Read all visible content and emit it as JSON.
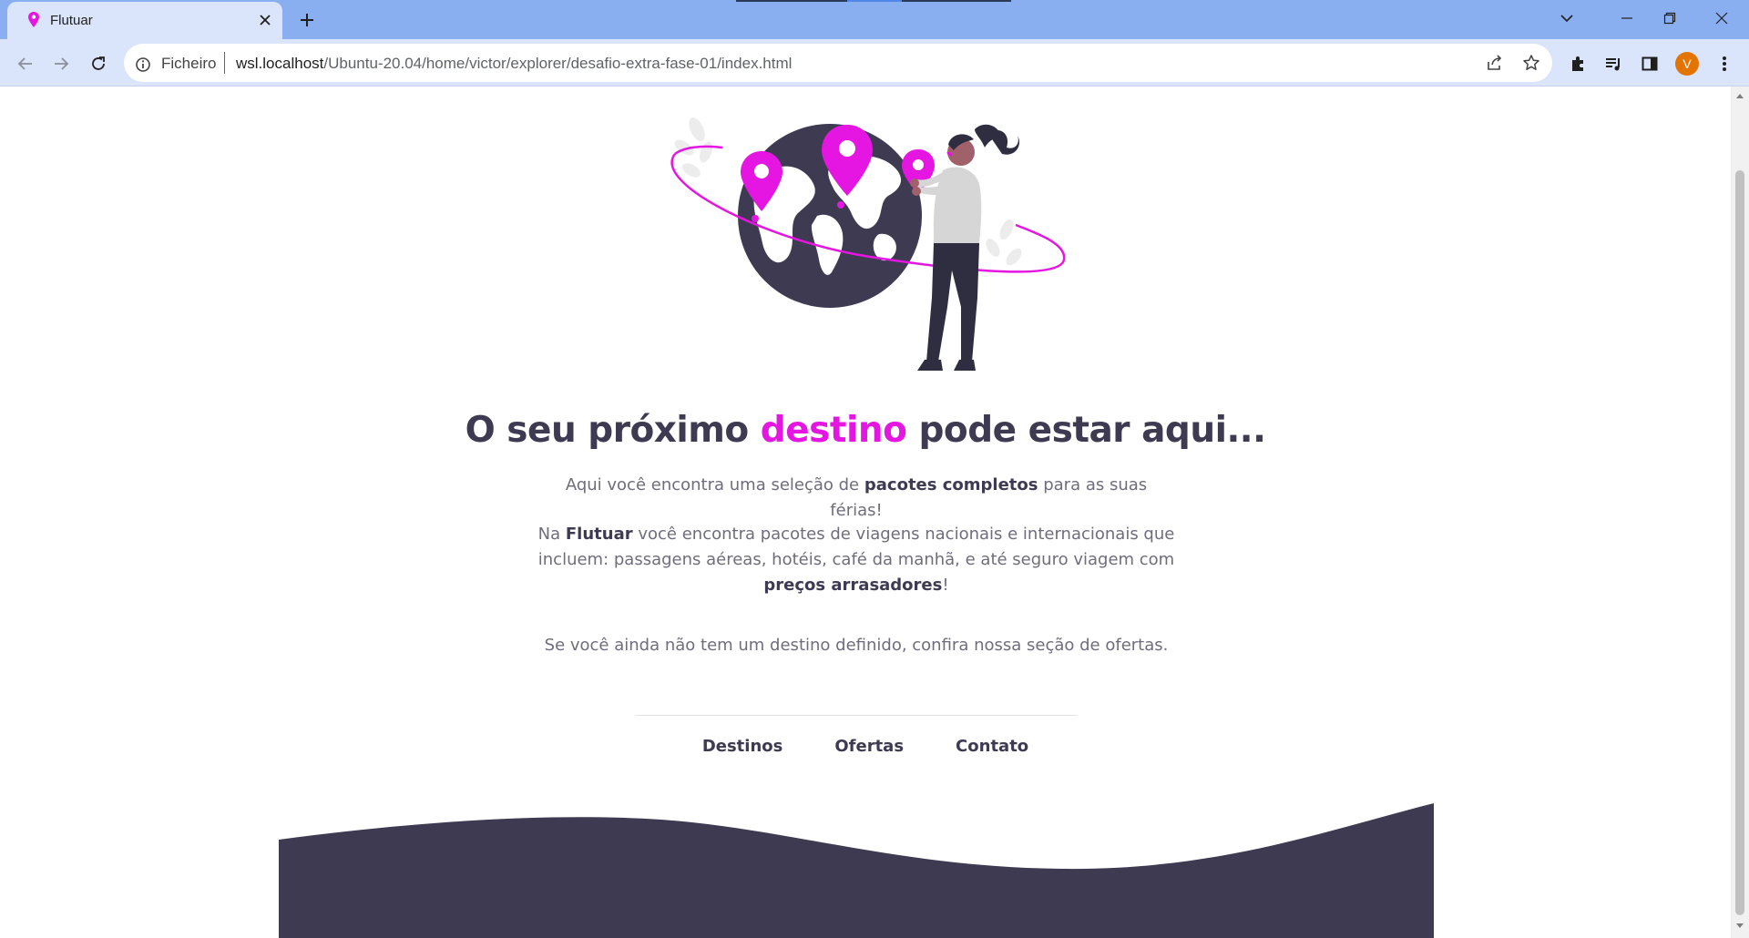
{
  "browser": {
    "tab_title": "Flutuar",
    "url_prefix": "Ficheiro",
    "url_host": "wsl.localhost",
    "url_path": "/Ubuntu-20.04/home/victor/explorer/desafio-extra-fase-01/index.html",
    "profile_initial": "V",
    "profile_color": "#e37400"
  },
  "page": {
    "headline": {
      "before": "O seu próximo",
      "accent": "destino",
      "after": "pode estar aqui..."
    },
    "intro": {
      "before": "Aqui você encontra uma seleção de",
      "bold": "pacotes completos",
      "after": "para as suas férias!"
    },
    "details": {
      "before": "Na",
      "brand": "Flutuar",
      "middle": "você encontra pacotes de viagens nacionais e internacionais que incluem: passagens aéreas, hotéis, café da manhã, e até seguro viagem com",
      "bold": "preços arrasadores",
      "after": "!"
    },
    "offers_note": "Se você ainda não tem um destino definido, confira nossa seção de ofertas.",
    "nav": [
      "Destinos",
      "Ofertas",
      "Contato"
    ],
    "colors": {
      "accent": "#e616e2",
      "dark": "#3d3a52",
      "text": "#6f6d7b"
    }
  }
}
